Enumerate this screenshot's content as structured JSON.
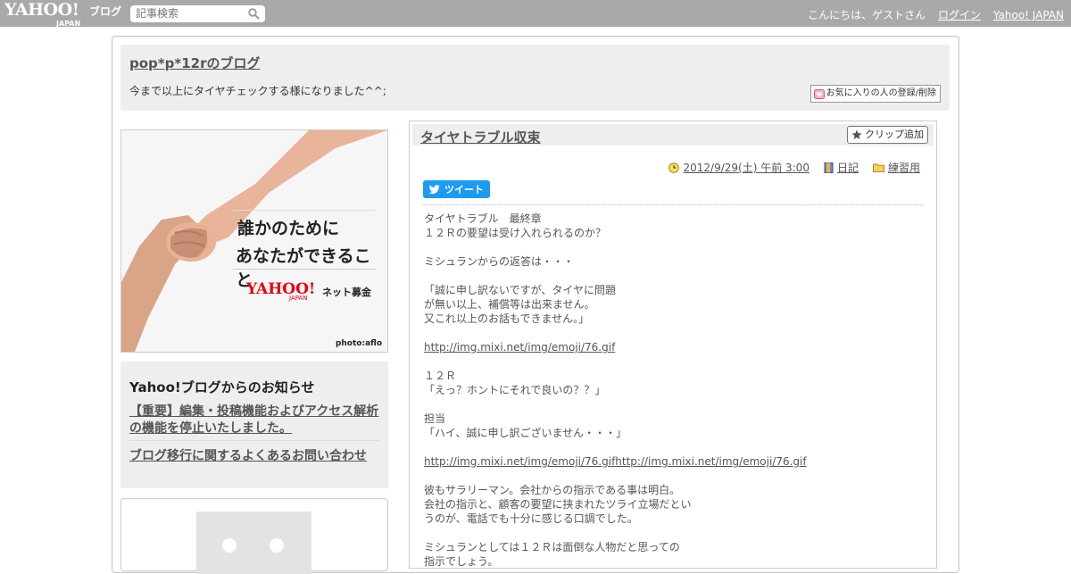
{
  "header": {
    "logo_text": "YAHOO!",
    "logo_sub": "JAPAN",
    "logo_suffix": "ブログ",
    "search_placeholder": "記事検索",
    "greeting": "こんにちは、ゲストさん",
    "login_link": "ログイン",
    "yahoo_link": "Yahoo! JAPAN"
  },
  "blog": {
    "title": "pop*p*12rのブログ",
    "description": "今まで以上にタイヤチェックする様になりました^^;",
    "favorite_button": "お気に入りの人の登録/削除"
  },
  "banner": {
    "line1": "誰かのために",
    "line2": "あなたができること",
    "logo": "YAHOO!",
    "logo_sub": "JAPAN",
    "tagline": "ネット募金",
    "credit": "photo:aflo"
  },
  "notice": {
    "heading": "Yahoo!ブログからのお知らせ",
    "items": [
      "【重要】編集・投稿機能およびアクセス解析の機能を停止いたしました。",
      "ブログ移行に関するよくあるお問い合わせ"
    ]
  },
  "article": {
    "title": "タイヤトラブル収束",
    "clip_button": "クリップ追加",
    "date": "2012/9/29(土) 午前 3:00",
    "category": "日記",
    "folder": "練習用",
    "tweet_label": "ツイート",
    "body": [
      "タイヤトラブル　最終章",
      "１２Ｒの要望は受け入れられるのか？",
      "",
      "ミシュランからの返答は・・・",
      "",
      "「誠に申し訳ないですが、タイヤに問題",
      "が無い以上、補償等は出来ません。",
      "又これ以上のお話もできません。」",
      "",
      "http://img.mixi.net/img/emoji/76.gif",
      "",
      "１２Ｒ",
      "「えっ？ホントにそれで良いの？？」",
      "",
      "担当",
      "「ハイ、誠に申し訳ございません・・・」",
      "",
      "http://img.mixi.net/img/emoji/76.gifhttp://img.mixi.net/img/emoji/76.gif",
      "",
      "彼もサラリーマン。会社からの指示である事は明白。",
      "会社の指示と、顧客の要望に挟まれたツライ立場だとい",
      "うのが、電話でも十分に感じる口調でした。",
      "",
      "ミシュランとしては１２Ｒは面倒な人物だと思っての",
      "指示でしょう。"
    ]
  },
  "colors": {
    "topbar": "#a9a9a9",
    "tweet": "#1d9bf0",
    "panel": "#eeeeee"
  }
}
